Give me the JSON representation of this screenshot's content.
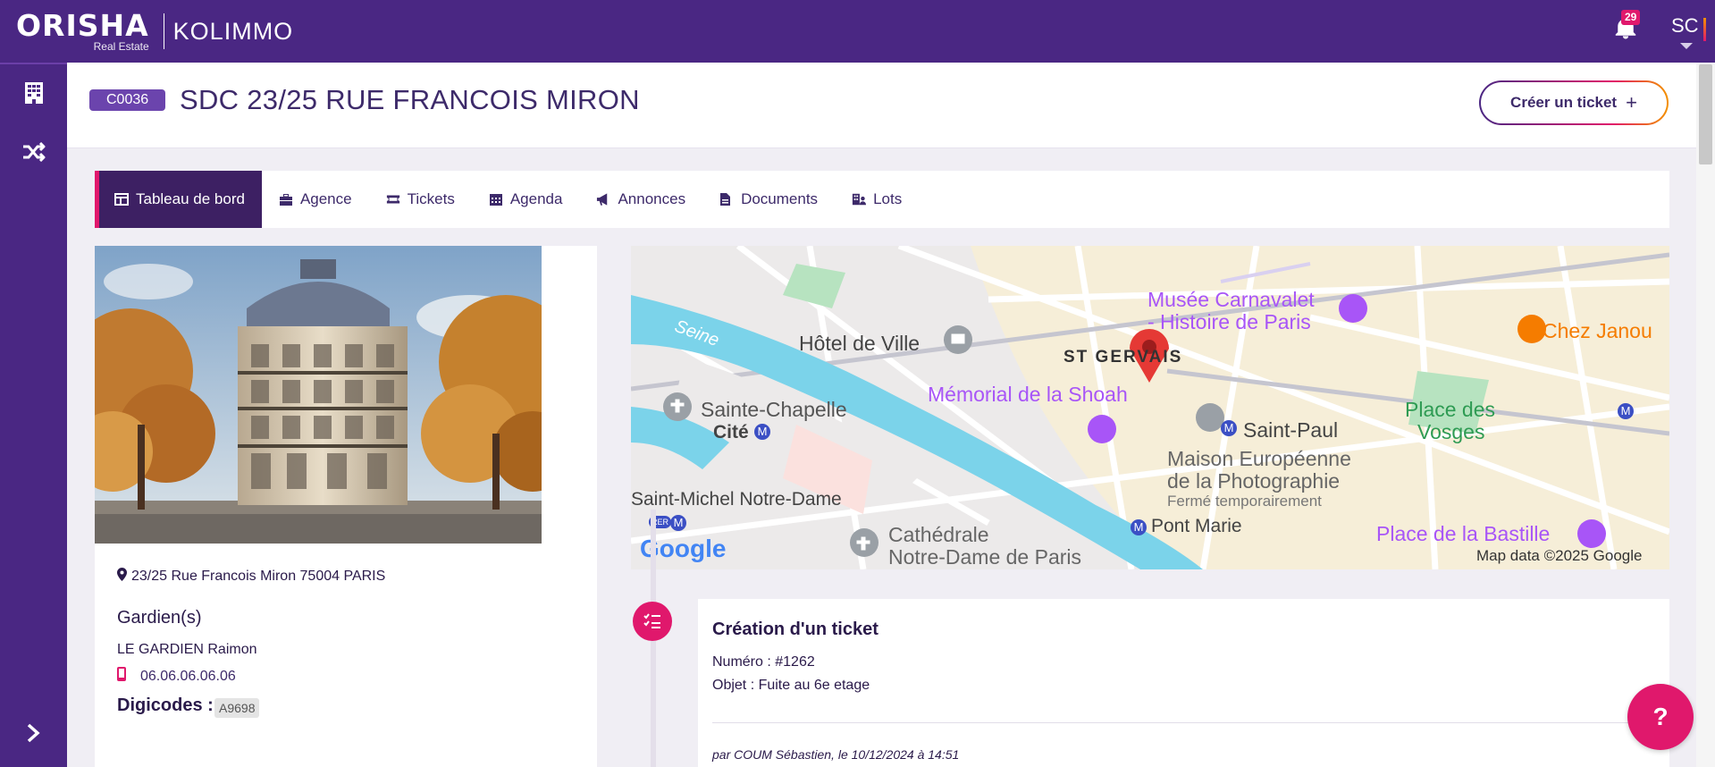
{
  "brand": {
    "name": "ORISHA",
    "sub": "Real Estate",
    "app": "KOLIMMO"
  },
  "topbar": {
    "notification_count": "29",
    "user_initials": "SC"
  },
  "header": {
    "code": "C0036",
    "title": "SDC 23/25 RUE FRANCOIS MIRON",
    "create_ticket": "Créer un ticket",
    "create_ticket_icon": "+"
  },
  "tabs": [
    {
      "label": "Tableau de bord",
      "icon": "dashboard-icon",
      "active": true
    },
    {
      "label": "Agence",
      "icon": "briefcase-icon"
    },
    {
      "label": "Tickets",
      "icon": "ticket-icon"
    },
    {
      "label": "Agenda",
      "icon": "calendar-icon"
    },
    {
      "label": "Annonces",
      "icon": "megaphone-icon"
    },
    {
      "label": "Documents",
      "icon": "document-icon"
    },
    {
      "label": "Lots",
      "icon": "lots-icon"
    }
  ],
  "building": {
    "address": "23/25 Rue Francois Miron 75004 PARIS",
    "guardians_title": "Gardien(s)",
    "guardian_name": "LE GARDIEN Raimon",
    "guardian_phone": "06.06.06.06.06",
    "digicodes_title": "Digicodes :",
    "digicode": "A9698"
  },
  "map": {
    "labels": {
      "seine": "Seine",
      "hotel_de_ville": "Hôtel de Ville",
      "st_gervais": "ST GERVAIS",
      "musee1": "Musée Carnavalet",
      "musee2": "- Histoire de Paris",
      "chez_janou": "Chez Janou",
      "memorial": "Mémorial de la Shoah",
      "sainte_chapelle": "Sainte-Chapelle",
      "cite": "Cité",
      "saint_paul": "Saint-Paul",
      "maison1": "Maison Européenne",
      "maison2": "de la Photographie",
      "ferme": "Fermé temporairement",
      "place_vosges1": "Place des",
      "place_vosges2": "Vosges",
      "saint_michel": "Saint-Michel Notre-Dame",
      "cathedrale1": "Cathédrale",
      "cathedrale2": "Notre-Dame de Paris",
      "pont_marie": "Pont Marie",
      "bastille": "Place de la Bastille",
      "metro_m": "M",
      "rer": "RER"
    },
    "logo": "Google",
    "attribution": "Map data ©2025 Google"
  },
  "timeline": {
    "title": "Création d'un ticket",
    "line1": "Numéro : #1262",
    "line2": "Objet : Fuite au 6e etage",
    "author": "par COUM Sébastien, le 10/12/2024 à 14:51"
  },
  "help": "?",
  "colors": {
    "primary": "#4a2783",
    "accent": "#e0186c",
    "orange": "#f39200"
  }
}
